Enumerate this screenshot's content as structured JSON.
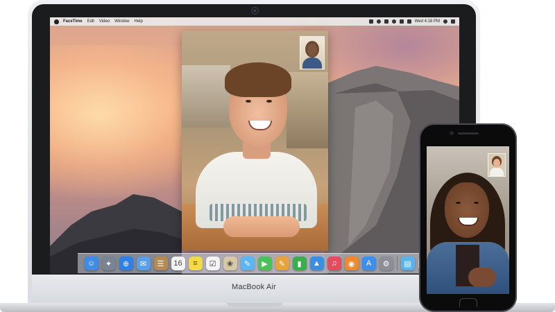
{
  "laptop": {
    "model_label": "MacBook Air"
  },
  "menubar": {
    "app_name": "FaceTime",
    "menus": [
      "Edit",
      "Video",
      "Window",
      "Help"
    ],
    "clock": "Wed 4:18 PM"
  },
  "dock": {
    "apps": [
      {
        "name": "finder-icon",
        "color": "#3f8be6",
        "glyph": "☺"
      },
      {
        "name": "launchpad-icon",
        "color": "#7a8391",
        "glyph": "✦"
      },
      {
        "name": "safari-icon",
        "color": "#2f7fe8",
        "glyph": "⊕"
      },
      {
        "name": "mail-icon",
        "color": "#5aa0e8",
        "glyph": "✉"
      },
      {
        "name": "contacts-icon",
        "color": "#b48a55",
        "glyph": "☰"
      },
      {
        "name": "calendar-icon",
        "color": "#f2f2f2",
        "glyph": "16"
      },
      {
        "name": "notes-icon",
        "color": "#f3da4b",
        "glyph": "≡"
      },
      {
        "name": "reminders-icon",
        "color": "#f4f4f4",
        "glyph": "☑"
      },
      {
        "name": "photos-icon",
        "color": "#d8c9a6",
        "glyph": "❀"
      },
      {
        "name": "messages-icon",
        "color": "#5cb6f2",
        "glyph": "✎"
      },
      {
        "name": "facetime-icon",
        "color": "#4cc15a",
        "glyph": "▶"
      },
      {
        "name": "ibooks-icon",
        "color": "#e8a33a",
        "glyph": "✎"
      },
      {
        "name": "numbers-icon",
        "color": "#3aae4c",
        "glyph": "▮"
      },
      {
        "name": "keynote-icon",
        "color": "#3a8fe0",
        "glyph": "▲"
      },
      {
        "name": "itunes-icon",
        "color": "#e34b5e",
        "glyph": "♫"
      },
      {
        "name": "ibooks-store-icon",
        "color": "#f0882e",
        "glyph": "◉"
      },
      {
        "name": "app-store-icon",
        "color": "#3c8ef0",
        "glyph": "A"
      },
      {
        "name": "system-preferences-icon",
        "color": "#8c8f95",
        "glyph": "⚙"
      }
    ],
    "right_items": [
      {
        "name": "folder-icon",
        "color": "#5ab4ea",
        "glyph": "▤"
      },
      {
        "name": "trash-icon",
        "color": "#c9ccd1",
        "glyph": "▥"
      }
    ]
  }
}
